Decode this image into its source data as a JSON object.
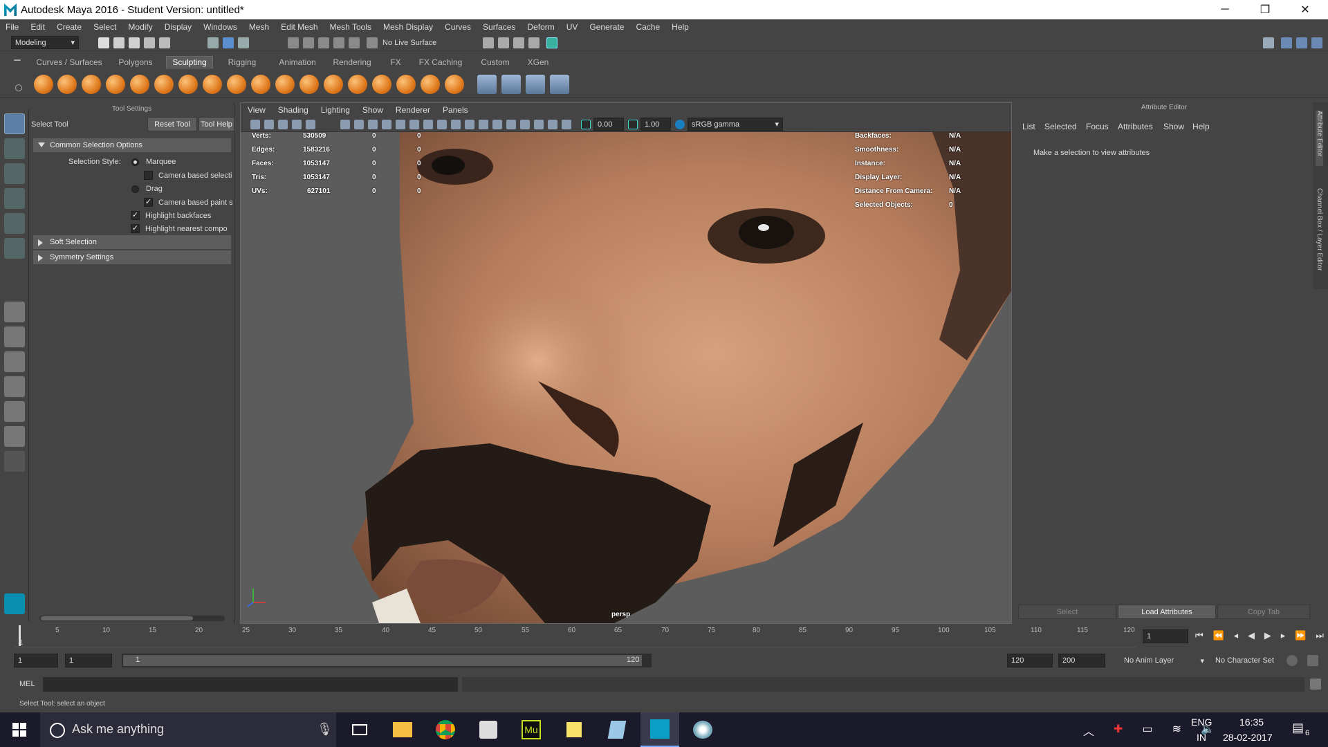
{
  "window": {
    "title": "Autodesk Maya 2016 - Student Version: untitled*",
    "minimize": "─",
    "restore": "❐",
    "close": "✕"
  },
  "menu": [
    "File",
    "Edit",
    "Create",
    "Select",
    "Modify",
    "Display",
    "Windows",
    "Mesh",
    "Edit Mesh",
    "Mesh Tools",
    "Mesh Display",
    "Curves",
    "Surfaces",
    "Deform",
    "UV",
    "Generate",
    "Cache",
    "Help"
  ],
  "toolbar": {
    "mode": "Modeling",
    "live_surface": "No Live Surface"
  },
  "shelf_tabs": [
    "Curves / Surfaces",
    "Polygons",
    "Sculpting",
    "Rigging",
    "Animation",
    "Rendering",
    "FX",
    "FX Caching",
    "Custom",
    "XGen"
  ],
  "active_shelf_tab": "Sculpting",
  "tool_settings": {
    "header": "Tool Settings",
    "tool_name": "Select Tool",
    "reset_button": "Reset Tool",
    "help_button": "Tool Help",
    "section_common": "Common Selection Options",
    "selection_style_label": "Selection Style:",
    "marquee": "Marquee",
    "camera_based_selection": "Camera based selecti",
    "drag": "Drag",
    "camera_based_paint": "Camera based paint s",
    "highlight_backfaces": "Highlight backfaces",
    "highlight_nearest": "Highlight nearest compo",
    "section_soft": "Soft Selection",
    "section_symmetry": "Symmetry Settings"
  },
  "viewport": {
    "menus": [
      "View",
      "Shading",
      "Lighting",
      "Show",
      "Renderer",
      "Panels"
    ],
    "exposure": "0.00",
    "gamma": "1.00",
    "color_space": "sRGB gamma",
    "camera": "persp",
    "hud_left": [
      {
        "label": "Verts:",
        "value": "530509",
        "a": "0",
        "b": "0"
      },
      {
        "label": "Edges:",
        "value": "1583216",
        "a": "0",
        "b": "0"
      },
      {
        "label": "Faces:",
        "value": "1053147",
        "a": "0",
        "b": "0"
      },
      {
        "label": "Tris:",
        "value": "1053147",
        "a": "0",
        "b": "0"
      },
      {
        "label": "UVs:",
        "value": "627101",
        "a": "0",
        "b": "0"
      }
    ],
    "hud_right": [
      {
        "label": "Backfaces:",
        "value": "N/A"
      },
      {
        "label": "Smoothness:",
        "value": "N/A"
      },
      {
        "label": "Instance:",
        "value": "N/A"
      },
      {
        "label": "Display Layer:",
        "value": "N/A"
      },
      {
        "label": "Distance From Camera:",
        "value": "N/A"
      },
      {
        "label": "Selected Objects:",
        "value": "0"
      }
    ]
  },
  "attribute_editor": {
    "header": "Attribute Editor",
    "menus": [
      "List",
      "Selected",
      "Focus",
      "Attributes",
      "Show",
      "Help"
    ],
    "message": "Make a selection to view attributes",
    "buttons": [
      "Select",
      "Load Attributes",
      "Copy Tab"
    ],
    "side_tabs": [
      "Attribute Editor",
      "Channel Box / Layer Editor"
    ]
  },
  "timeline": {
    "ticks": [
      "1",
      "5",
      "10",
      "15",
      "20",
      "25",
      "30",
      "35",
      "40",
      "45",
      "50",
      "55",
      "60",
      "65",
      "70",
      "75",
      "80",
      "85",
      "90",
      "95",
      "100",
      "105",
      "110",
      "115",
      "120"
    ],
    "current_frame": "1"
  },
  "range": {
    "start": "1",
    "anim_start": "1",
    "slider_start": "1",
    "slider_end": "120",
    "end": "120",
    "anim_end": "200",
    "anim_layer": "No Anim Layer",
    "character_set": "No Character Set"
  },
  "command": {
    "label": "MEL"
  },
  "help_line": "Select Tool: select an object",
  "taskbar": {
    "search": "Ask me anything",
    "lang1": "ENG",
    "lang2": "IN",
    "time": "16:35",
    "date": "28-02-2017",
    "notifications": "6"
  }
}
